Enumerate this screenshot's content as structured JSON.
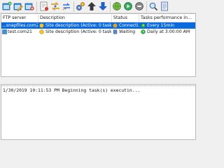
{
  "header": {
    "ftp_server": "FTP server",
    "description": "Description",
    "status": "Status",
    "tasks_performance": "Tasks performance in..."
  },
  "rows": [
    {
      "server": "...snapfiles.com21",
      "description": "Site description (Active: 0 task(s), Pa...",
      "status": "Connecti...",
      "schedule": "Every 15min",
      "selected": true
    },
    {
      "server": "test.com21",
      "description": "Site description (Active: 0 task(s), Pa...",
      "status": "Waiting",
      "schedule": "Daily at 3:00:00 AM",
      "selected": false
    }
  ],
  "log": {
    "line": "1/30/2019 10:11:53 PM Beginning task(s) executin..."
  },
  "colors": {
    "selection": "#0a6ae0",
    "arrow_blue": "#1f5fd0",
    "arrow_dark": "#3a3a3a"
  }
}
